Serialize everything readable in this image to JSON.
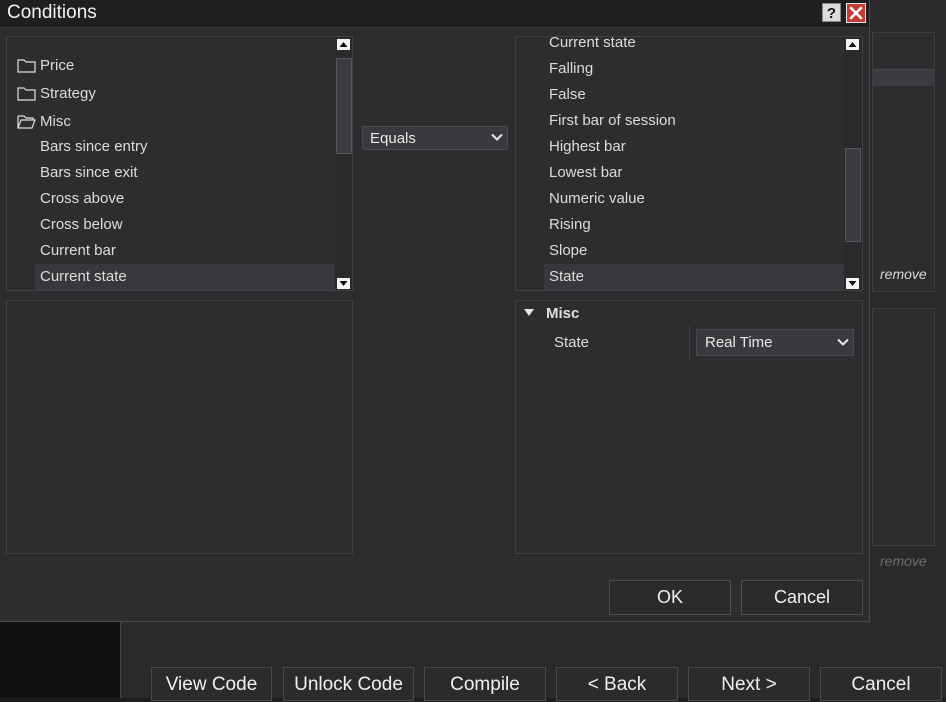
{
  "dialog": {
    "title": "Conditions",
    "help_label": "?",
    "ok_label": "OK",
    "cancel_label": "Cancel"
  },
  "left_tree": {
    "folders": [
      "Price",
      "Strategy",
      "Misc"
    ],
    "items": [
      "Bars since entry",
      "Bars since exit",
      "Cross above",
      "Cross below",
      "Current bar",
      "Current state"
    ],
    "selected": "Current state"
  },
  "operator": {
    "value": "Equals"
  },
  "right_list": {
    "partial_top": "Current state",
    "items": [
      "Falling",
      "False",
      "First bar of session",
      "Highest bar",
      "Lowest bar",
      "Numeric value",
      "Rising",
      "Slope",
      "State"
    ],
    "selected": "State"
  },
  "properties": {
    "section": "Misc",
    "label": "State",
    "value": "Real Time"
  },
  "background": {
    "remove_label": "remove",
    "buttons": [
      "View Code",
      "Unlock Code",
      "Compile",
      "< Back",
      "Next >",
      "Cancel"
    ]
  }
}
